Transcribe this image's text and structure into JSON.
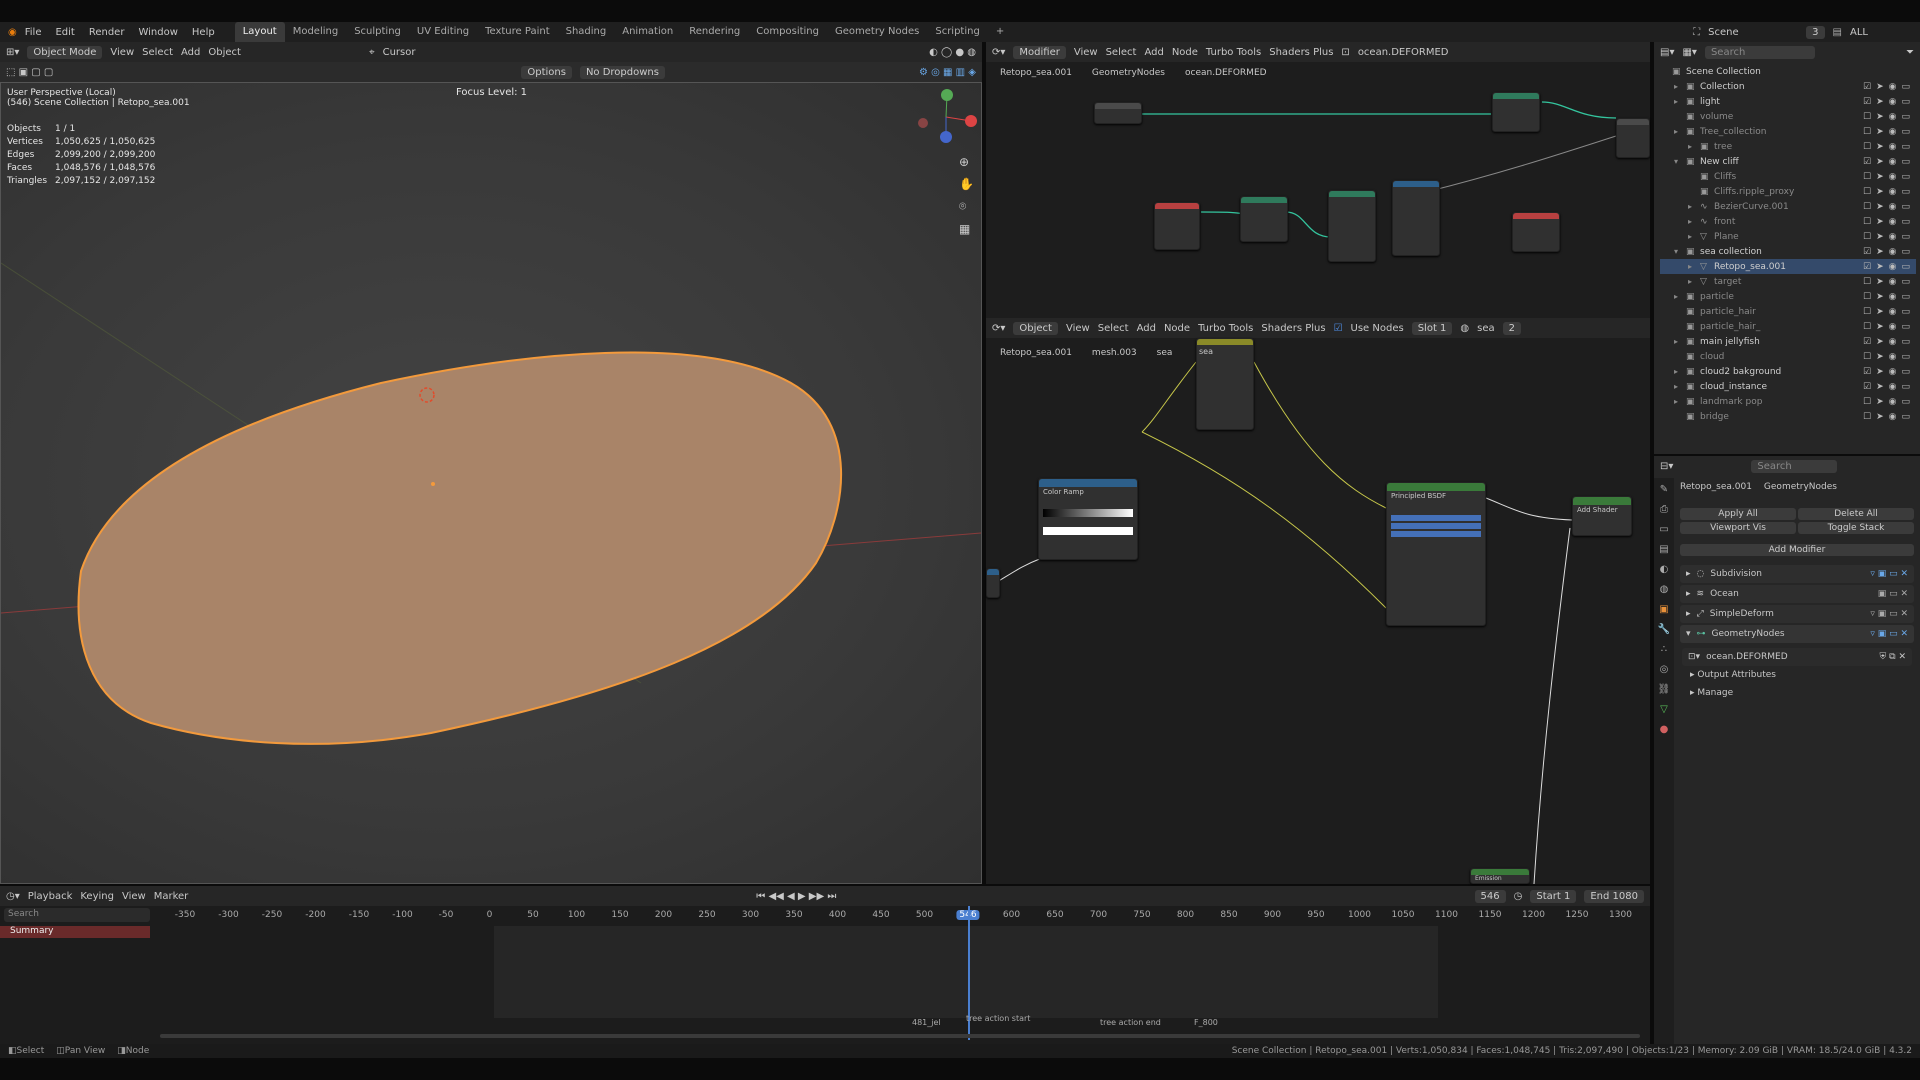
{
  "app_menu": [
    "File",
    "Edit",
    "Render",
    "Window",
    "Help"
  ],
  "workspaces": [
    "Layout",
    "Modeling",
    "Sculpting",
    "UV Editing",
    "Texture Paint",
    "Shading",
    "Animation",
    "Rendering",
    "Compositing",
    "Geometry Nodes",
    "Scripting"
  ],
  "active_workspace": "Layout",
  "add_tab": "+",
  "scene_name": "Scene",
  "scene_count": "3",
  "view_layer": "ALL",
  "viewport": {
    "mode": "Object Mode",
    "menus": [
      "View",
      "Select",
      "Add",
      "Object"
    ],
    "cursor": "Cursor",
    "options": "Options",
    "dropdowns": "No Dropdowns",
    "focus_level": "Focus Level: 1",
    "view_name": "User Perspective (Local)",
    "collection_line": "(546) Scene Collection | Retopo_sea.001",
    "stats": [
      {
        "k": "Objects",
        "v": "1 / 1"
      },
      {
        "k": "Vertices",
        "v": "1,050,625 / 1,050,625"
      },
      {
        "k": "Edges",
        "v": "2,099,200 / 2,099,200"
      },
      {
        "k": "Faces",
        "v": "1,048,576 / 1,048,576"
      },
      {
        "k": "Triangles",
        "v": "2,097,152 / 2,097,152"
      }
    ]
  },
  "geo_editor": {
    "type": "Modifier",
    "menus": [
      "View",
      "Select",
      "Add",
      "Node",
      "Turbo Tools",
      "Shaders Plus"
    ],
    "tree_name": "ocean.DEFORMED",
    "breadcrumb": [
      "Retopo_sea.001",
      "GeometryNodes",
      "ocean.DEFORMED"
    ]
  },
  "shader_editor": {
    "type": "Object",
    "menus": [
      "View",
      "Select",
      "Add",
      "Node",
      "Turbo Tools",
      "Shaders Plus"
    ],
    "use_nodes": "Use Nodes",
    "slot": "Slot 1",
    "material": "sea",
    "user_count": "2",
    "breadcrumb": [
      "Retopo_sea.001",
      "mesh.003",
      "sea"
    ],
    "nodes": {
      "mix_title": "sea",
      "color_ramp": "Color Ramp",
      "principled": "Principled BSDF",
      "output": "Add Shader",
      "emission": "Emission"
    }
  },
  "outliner": {
    "search_placeholder": "Search",
    "rows": [
      {
        "label": "Scene Collection",
        "depth": 0,
        "tri": "",
        "icon": "▣",
        "flags": ""
      },
      {
        "label": "Collection",
        "depth": 1,
        "tri": "▸",
        "icon": "▣",
        "flags": "on"
      },
      {
        "label": "light",
        "depth": 1,
        "tri": "▸",
        "icon": "▣",
        "flags": "on"
      },
      {
        "label": "volume",
        "depth": 1,
        "tri": "",
        "icon": "▣",
        "flags": "off"
      },
      {
        "label": "Tree_collection",
        "depth": 1,
        "tri": "▸",
        "icon": "▣",
        "flags": "off"
      },
      {
        "label": "tree",
        "depth": 2,
        "tri": "▸",
        "icon": "▣",
        "flags": "off"
      },
      {
        "label": "New cliff",
        "depth": 1,
        "tri": "▾",
        "icon": "▣",
        "flags": "on"
      },
      {
        "label": "Cliffs",
        "depth": 2,
        "tri": "",
        "icon": "▣",
        "flags": "off"
      },
      {
        "label": "Cliffs.ripple_proxy",
        "depth": 2,
        "tri": "",
        "icon": "▣",
        "flags": "off"
      },
      {
        "label": "BezierCurve.001",
        "depth": 2,
        "tri": "▸",
        "icon": "∿",
        "flags": "off"
      },
      {
        "label": "front",
        "depth": 2,
        "tri": "▸",
        "icon": "∿",
        "flags": "off"
      },
      {
        "label": "Plane",
        "depth": 2,
        "tri": "▸",
        "icon": "▽",
        "flags": "off"
      },
      {
        "label": "sea collection",
        "depth": 1,
        "tri": "▾",
        "icon": "▣",
        "flags": "on"
      },
      {
        "label": "Retopo_sea.001",
        "depth": 2,
        "tri": "▸",
        "icon": "▽",
        "flags": "sel"
      },
      {
        "label": "target",
        "depth": 2,
        "tri": "▸",
        "icon": "▽",
        "flags": "off"
      },
      {
        "label": "particle",
        "depth": 1,
        "tri": "▸",
        "icon": "▣",
        "flags": "off"
      },
      {
        "label": "particle_hair",
        "depth": 1,
        "tri": "",
        "icon": "▣",
        "flags": "off"
      },
      {
        "label": "particle_hair_",
        "depth": 1,
        "tri": "",
        "icon": "▣",
        "flags": "off"
      },
      {
        "label": "main jellyfish",
        "depth": 1,
        "tri": "▸",
        "icon": "▣",
        "flags": "on"
      },
      {
        "label": "cloud",
        "depth": 1,
        "tri": "",
        "icon": "▣",
        "flags": "off"
      },
      {
        "label": "cloud2 bakground",
        "depth": 1,
        "tri": "▸",
        "icon": "▣",
        "flags": "on"
      },
      {
        "label": "cloud_instance",
        "depth": 1,
        "tri": "▸",
        "icon": "▣",
        "flags": "on"
      },
      {
        "label": "landmark pop",
        "depth": 1,
        "tri": "▸",
        "icon": "▣",
        "flags": "off"
      },
      {
        "label": "bridge",
        "depth": 1,
        "tri": "",
        "icon": "▣",
        "flags": "off"
      }
    ]
  },
  "properties": {
    "search_placeholder": "Search",
    "object": "Retopo_sea.001",
    "modifier_crumb": "GeometryNodes",
    "apply_all": "Apply All",
    "delete_all": "Delete All",
    "viewport_vis": "Viewport Vis",
    "toggle_stack": "Toggle Stack",
    "add_modifier": "Add Modifier",
    "modifiers": [
      "Subdivision",
      "Ocean",
      "SimpleDeform",
      "GeometryNodes"
    ],
    "node_group": "ocean.DEFORMED",
    "output_attributes": "Output Attributes",
    "manage": "Manage"
  },
  "timeline": {
    "menus": [
      "Playback",
      "Keying",
      "View",
      "Marker"
    ],
    "search_placeholder": "Search",
    "summary": "Summary",
    "current_frame": "546",
    "start_label": "Start",
    "start": "1",
    "end_label": "End",
    "end": "1080",
    "ticks": [
      "-350",
      "-300",
      "-250",
      "-200",
      "-150",
      "-100",
      "-50",
      "0",
      "50",
      "100",
      "150",
      "200",
      "250",
      "300",
      "350",
      "400",
      "450",
      "500",
      "546",
      "600",
      "650",
      "700",
      "750",
      "800",
      "850",
      "900",
      "950",
      "1000",
      "1050",
      "1100",
      "1150",
      "1200",
      "1250",
      "1300"
    ],
    "markers": [
      "481_jel",
      "tree action start",
      "tree action end",
      "F_800"
    ]
  },
  "status": {
    "select": "Select",
    "pan": "Pan View",
    "node": "Node",
    "info": "Scene Collection | Retopo_sea.001 | Verts:1,050,834 | Faces:1,048,745 | Tris:2,097,490 | Objects:1/23 | Memory: 2.09 GiB | VRAM: 18.5/24.0 GiB | 4.3.2"
  }
}
